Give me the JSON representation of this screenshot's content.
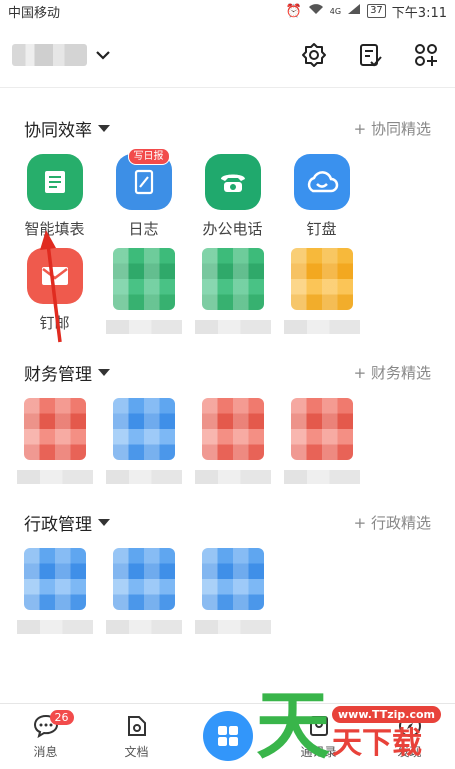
{
  "status": {
    "carrier": "中国移动",
    "battery": "37",
    "time": "下午3:11",
    "network": "4G"
  },
  "sections": [
    {
      "title": "协同效率",
      "link": "+ 协同精选"
    },
    {
      "title": "财务管理",
      "link": "+ 财务精选"
    },
    {
      "title": "行政管理",
      "link": "+ 行政精选"
    }
  ],
  "apps": [
    {
      "label": "智能填表",
      "color": "#27ae6b"
    },
    {
      "label": "日志",
      "color": "#3d8fe6",
      "badge": "写日报"
    },
    {
      "label": "办公电话",
      "color": "#20a96d"
    },
    {
      "label": "钉盘",
      "color": "#3a91ee"
    },
    {
      "label": "钉邮",
      "color": "#ef5a4d"
    }
  ],
  "tabs": [
    {
      "label": "消息",
      "count": "26"
    },
    {
      "label": "文档"
    },
    {
      "label": ""
    },
    {
      "label": "通讯录"
    },
    {
      "label": "发现"
    }
  ],
  "watermark": {
    "big": "天",
    "url": "www.TTzip.com",
    "small": "天下载"
  }
}
